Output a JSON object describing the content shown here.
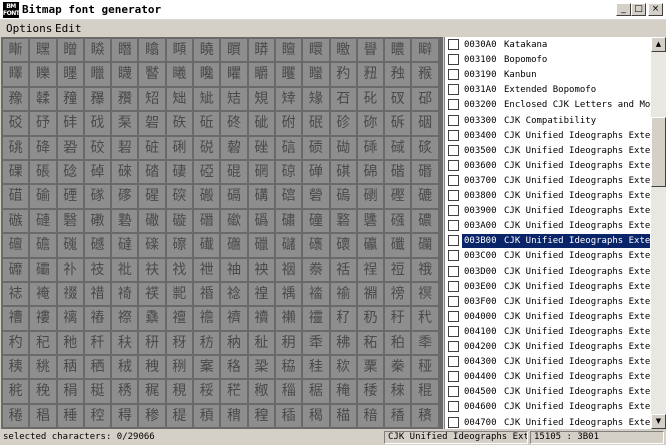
{
  "window": {
    "icon_text": "BM FONT",
    "title": "Bitmap font generator",
    "controls": {
      "minimize": "_",
      "maximize": "□",
      "close": "×"
    }
  },
  "menu": {
    "items": [
      "Options",
      "Edit"
    ]
  },
  "glyph_rows": [
    [
      "䁪",
      "䁫",
      "䁬",
      "䁭",
      "䁮",
      "䁯",
      "䁰",
      "䁱",
      "䁲",
      "䁳",
      "䁴",
      "䁵",
      "䁶",
      "䁷",
      "䁸",
      "䁹"
    ],
    [
      "䁺",
      "䁻",
      "䁼",
      "䁽",
      "䁾",
      "䁿",
      "䂀",
      "䂁",
      "䂂",
      "䂃",
      "䂄",
      "䂅",
      "䂆",
      "䂇",
      "䂈",
      "䂉"
    ],
    [
      "䂊",
      "䂋",
      "䂌",
      "䂍",
      "䂎",
      "䂏",
      "䂐",
      "䂑",
      "䂒",
      "䂓",
      "䂔",
      "䂕",
      "䂖",
      "䂗",
      "䂘",
      "䂙"
    ],
    [
      "䂚",
      "䂛",
      "䂜",
      "䂝",
      "䂞",
      "䂟",
      "䂠",
      "䂡",
      "䂢",
      "䂣",
      "䂤",
      "䂥",
      "䂦",
      "䂧",
      "䂨",
      "䂩"
    ],
    [
      "䂪",
      "䂫",
      "䂬",
      "䂭",
      "䂮",
      "䂯",
      "䂰",
      "䂱",
      "䂲",
      "䂳",
      "䂴",
      "䂵",
      "䂶",
      "䂷",
      "䂸",
      "䂹"
    ],
    [
      "䂺",
      "䂻",
      "䂼",
      "䂽",
      "䂾",
      "䂿",
      "䃀",
      "䃁",
      "䃂",
      "䃃",
      "䃄",
      "䃅",
      "䃆",
      "䃇",
      "䃈",
      "䃉"
    ],
    [
      "䃊",
      "䃋",
      "䃌",
      "䃍",
      "䃎",
      "䃏",
      "䃐",
      "䃑",
      "䃒",
      "䃓",
      "䃔",
      "䃕",
      "䃖",
      "䃗",
      "䃘",
      "䃙"
    ],
    [
      "䃚",
      "䃛",
      "䃜",
      "䃝",
      "䃞",
      "䃟",
      "䃠",
      "䃡",
      "䃢",
      "䃣",
      "䃤",
      "䃥",
      "䃦",
      "䃧",
      "䃨",
      "䃩"
    ],
    [
      "䃪",
      "䃫",
      "䃬",
      "䃭",
      "䃮",
      "䃯",
      "䃰",
      "䃱",
      "䃲",
      "䃳",
      "䃴",
      "䃵",
      "䃶",
      "䃷",
      "䃸",
      "䃹"
    ],
    [
      "䃺",
      "䃻",
      "䃼",
      "䃽",
      "䃾",
      "䃿",
      "䄀",
      "䄁",
      "䄂",
      "䄃",
      "䄄",
      "䄅",
      "䄆",
      "䄇",
      "䄈",
      "䄉"
    ],
    [
      "䄊",
      "䄋",
      "䄌",
      "䄍",
      "䄎",
      "䄏",
      "䄐",
      "䄑",
      "䄒",
      "䄓",
      "䄔",
      "䄕",
      "䄖",
      "䄗",
      "䄘",
      "䄙"
    ],
    [
      "䄚",
      "䄛",
      "䄜",
      "䄝",
      "䄞",
      "䄟",
      "䄠",
      "䄡",
      "䄢",
      "䄣",
      "䄤",
      "䄥",
      "䄦",
      "䄧",
      "䄨",
      "䄩"
    ],
    [
      "䄪",
      "䄫",
      "䄬",
      "䄭",
      "䄮",
      "䄯",
      "䄰",
      "䄱",
      "䄲",
      "䄳",
      "䄴",
      "䄵",
      "䄶",
      "䄷",
      "䄸",
      "䄹"
    ],
    [
      "䄺",
      "䄻",
      "䄼",
      "䄽",
      "䄾",
      "䄿",
      "䅀",
      "䅁",
      "䅂",
      "䅃",
      "䅄",
      "䅅",
      "䅆",
      "䅇",
      "䅈",
      "䅉"
    ],
    [
      "䅊",
      "䅋",
      "䅌",
      "䅍",
      "䅎",
      "䅏",
      "䅐",
      "䅑",
      "䅒",
      "䅓",
      "䅔",
      "䅕",
      "䅖",
      "䅗",
      "䅘",
      "䅙"
    ],
    [
      "䅚",
      "䅛",
      "䅜",
      "䅝",
      "䅞",
      "䅟",
      "䅠",
      "䅡",
      "䅢",
      "䅣",
      "䅤",
      "䅥",
      "䅦",
      "䅧",
      "䅨",
      "䅩"
    ]
  ],
  "blocks": [
    {
      "code": "0030A0",
      "name": "Katakana",
      "selected": false
    },
    {
      "code": "003100",
      "name": "Bopomofo",
      "selected": false
    },
    {
      "code": "003190",
      "name": "Kanbun",
      "selected": false
    },
    {
      "code": "0031A0",
      "name": "Extended Bopomofo",
      "selected": false
    },
    {
      "code": "003200",
      "name": "Enclosed CJK Letters and Mo.",
      "selected": false
    },
    {
      "code": "003300",
      "name": "CJK Compatibility",
      "selected": false
    },
    {
      "code": "003400",
      "name": "CJK Unified Ideographs Exte.",
      "selected": false
    },
    {
      "code": "003500",
      "name": "CJK Unified Ideographs Exte.",
      "selected": false
    },
    {
      "code": "003600",
      "name": "CJK Unified Ideographs Exte.",
      "selected": false
    },
    {
      "code": "003700",
      "name": "CJK Unified Ideographs Exte.",
      "selected": false
    },
    {
      "code": "003800",
      "name": "CJK Unified Ideographs Exte.",
      "selected": false
    },
    {
      "code": "003900",
      "name": "CJK Unified Ideographs Exte.",
      "selected": false
    },
    {
      "code": "003A00",
      "name": "CJK Unified Ideographs Exte.",
      "selected": false
    },
    {
      "code": "003B00",
      "name": "CJK Unified Ideographs Exte.",
      "selected": true
    },
    {
      "code": "003C00",
      "name": "CJK Unified Ideographs Exte.",
      "selected": false
    },
    {
      "code": "003D00",
      "name": "CJK Unified Ideographs Exte.",
      "selected": false
    },
    {
      "code": "003E00",
      "name": "CJK Unified Ideographs Exte.",
      "selected": false
    },
    {
      "code": "003F00",
      "name": "CJK Unified Ideographs Exte.",
      "selected": false
    },
    {
      "code": "004000",
      "name": "CJK Unified Ideographs Exte.",
      "selected": false
    },
    {
      "code": "004100",
      "name": "CJK Unified Ideographs Exte.",
      "selected": false
    },
    {
      "code": "004200",
      "name": "CJK Unified Ideographs Exte.",
      "selected": false
    },
    {
      "code": "004300",
      "name": "CJK Unified Ideographs Exte.",
      "selected": false
    },
    {
      "code": "004400",
      "name": "CJK Unified Ideographs Exte.",
      "selected": false
    },
    {
      "code": "004500",
      "name": "CJK Unified Ideographs Exte.",
      "selected": false
    },
    {
      "code": "004600",
      "name": "CJK Unified Ideographs Exte.",
      "selected": false
    },
    {
      "code": "004700",
      "name": "CJK Unified Ideographs Exte.",
      "selected": false
    }
  ],
  "scrollbar": {
    "up_glyph": "▲",
    "down_glyph": "▼"
  },
  "status": {
    "selected_characters": "selected characters: 0/29066",
    "block_name": "CJK Unified Ideographs Extension",
    "char_code": "15105 : 3B01"
  },
  "colors": {
    "selection": "#0a246a",
    "grid_background": "#6a6a6a",
    "cell_background": "#8e8e8e",
    "chrome": "#d4d0c8"
  }
}
